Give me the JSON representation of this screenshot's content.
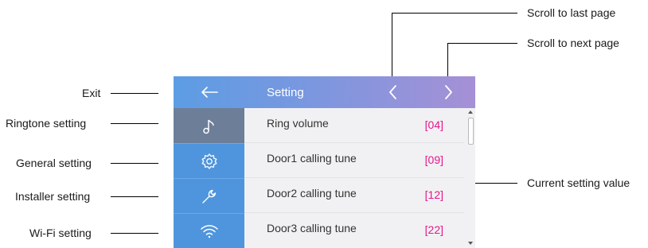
{
  "annotations": {
    "exit": "Exit",
    "ringtone_setting": "Ringtone setting",
    "general_setting": "General setting",
    "installer_setting": "Installer setting",
    "wifi_setting": "Wi-Fi setting",
    "scroll_last": "Scroll to last page",
    "scroll_next": "Scroll to next page",
    "current_value": "Current setting value"
  },
  "screen": {
    "title": "Setting",
    "sidebar": [
      {
        "icon": "back-arrow-icon"
      },
      {
        "icon": "music-note-icon",
        "active": true
      },
      {
        "icon": "gear-icon"
      },
      {
        "icon": "wrench-icon"
      },
      {
        "icon": "wifi-icon"
      }
    ],
    "rows": [
      {
        "label": "Ring volume",
        "value": "[04]"
      },
      {
        "label": "Door1 calling tune",
        "value": "[09]"
      },
      {
        "label": "Door2 calling tune",
        "value": "[12]"
      },
      {
        "label": "Door3 calling tune",
        "value": "[22]"
      }
    ],
    "colors": {
      "sidebar": "#4f95dd",
      "active": "#6d7f98",
      "value": "#e5178b"
    }
  }
}
